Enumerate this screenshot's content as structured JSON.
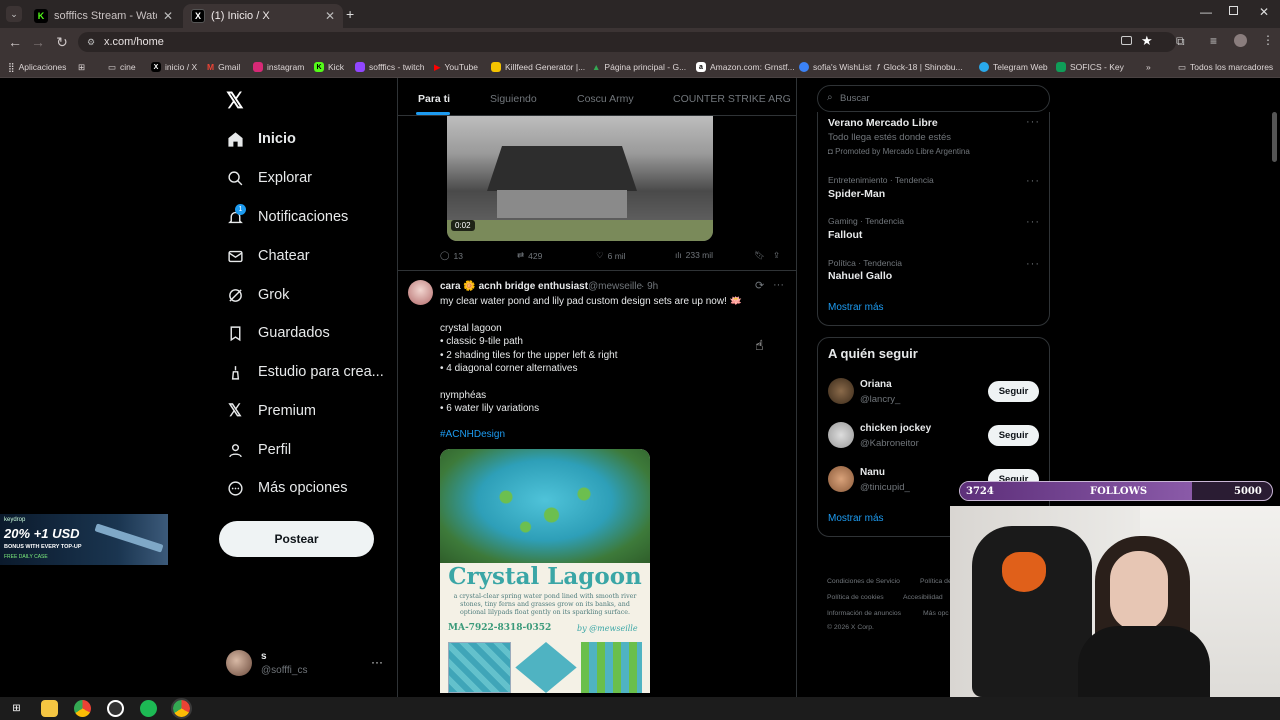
{
  "browser": {
    "tabs": [
      {
        "title": "sofffics Stream - Watch Live on",
        "icon": "kick-icon",
        "color": "#53fc18"
      },
      {
        "title": "(1) Inicio / X",
        "icon": "x-logo-icon",
        "color": "#ffffff"
      }
    ],
    "url": "x.com/home",
    "bookmarks": [
      "Aplicaciones",
      "cine",
      "inicio / X",
      "Gmail",
      "instagram",
      "Kick",
      "sofffics - twitch",
      "YouTube",
      "Killfeed Generator |...",
      "Página principal - G...",
      "Amazon.com: Grnstf...",
      "sofia's WishList",
      "Glock-18 | Shinobu...",
      "Telegram Web",
      "SOFICS - Key"
    ],
    "all_bookmarks": "Todos los marcadores"
  },
  "sidebar": {
    "items": [
      {
        "label": "Inicio",
        "icon": "home-icon"
      },
      {
        "label": "Explorar",
        "icon": "search-icon"
      },
      {
        "label": "Notificaciones",
        "icon": "bell-icon",
        "badge": "1"
      },
      {
        "label": "Chatear",
        "icon": "mail-icon"
      },
      {
        "label": "Grok",
        "icon": "grok-icon"
      },
      {
        "label": "Guardados",
        "icon": "bookmark-icon"
      },
      {
        "label": "Estudio para crea...",
        "icon": "creator-studio-icon"
      },
      {
        "label": "Premium",
        "icon": "x-logo-icon"
      },
      {
        "label": "Perfil",
        "icon": "person-icon"
      },
      {
        "label": "Más opciones",
        "icon": "more-circle-icon"
      }
    ],
    "post_button": "Postear",
    "account": {
      "name": "s",
      "handle": "@sofffi_cs"
    }
  },
  "feed": {
    "tabs": [
      "Para ti",
      "Siguiendo",
      "Coscu Army",
      "COUNTER STRIKE ARG"
    ],
    "video_time": "0:02",
    "prev_actions": {
      "replies": "13",
      "reposts": "429",
      "likes": "6 mil",
      "views": "233 mil"
    },
    "tweet": {
      "name": "cara 🌼 acnh bridge enthusiast",
      "handle": "@mewseille",
      "time": "· 9h",
      "lines": [
        "my clear water pond and lily pad custom design sets are up now! 🪷",
        "",
        "crystal lagoon",
        "• classic 9-tile path",
        "• 2 shading tiles for the upper left & right",
        "• 4 diagonal corner alternatives",
        "",
        "nymphéas",
        "• 6 water lily variations"
      ],
      "hashtag": "#ACNHDesign",
      "image_title": "Crystal Lagoon",
      "image_desc": "a crystal-clear spring water pond lined with smooth river stones, tiny ferns and grasses grow on its banks, and optional lilypads float gently on its sparkling surface.",
      "image_code": "MA-7922-8318-0352",
      "image_by": "by @mewseille"
    }
  },
  "right": {
    "search_placeholder": "Buscar",
    "promo": {
      "title": "Verano Mercado Libre",
      "subtitle": "Todo llega estés donde estés",
      "promoted": "Promoted by Mercado Libre Argentina"
    },
    "trends": [
      {
        "category": "Entretenimiento · Tendencia",
        "name": "Spider-Man"
      },
      {
        "category": "Gaming · Tendencia",
        "name": "Fallout"
      },
      {
        "category": "Política · Tendencia",
        "name": "Nahuel Gallo"
      }
    ],
    "show_more": "Mostrar más",
    "who_to_follow": "A quién seguir",
    "follow_label": "Seguir",
    "suggestions": [
      {
        "name": "Oriana",
        "handle": "@lancry_"
      },
      {
        "name": "chicken jockey",
        "handle": "@Kabroneitor"
      },
      {
        "name": "Nanu",
        "handle": "@tinicupid_"
      }
    ],
    "footer": [
      "Condiciones de Servicio",
      "Política de",
      "Política de cookies",
      "Accesibilidad",
      "Información de anuncios",
      "Más opc",
      "© 2026 X Corp."
    ]
  },
  "overlay": {
    "follows_current": "3724",
    "follows_label": "FOLLOWS",
    "follows_goal": "5000",
    "follows_progress": 0.745,
    "ad_line1": "20% +1 USD",
    "ad_line2": "BONUS WITH EVERY TOP-UP",
    "ad_line3": "FREE DAILY CASE",
    "ad_brand": "keydrop"
  }
}
